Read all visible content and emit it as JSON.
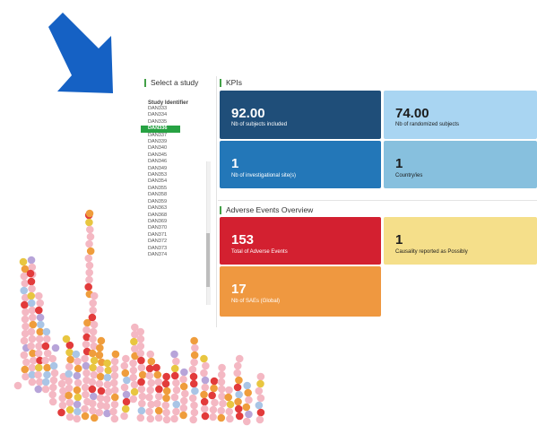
{
  "sidebar": {
    "title": "Select a study",
    "column_header": "Study Identifier",
    "items": [
      {
        "label": "DAN333",
        "active": false
      },
      {
        "label": "DAN334",
        "active": false
      },
      {
        "label": "DAN335",
        "active": false
      },
      {
        "label": "DAN336",
        "active": true
      },
      {
        "label": "DAN337",
        "active": false
      },
      {
        "label": "DAN339",
        "active": false
      },
      {
        "label": "DAN340",
        "active": false
      },
      {
        "label": "DAN345",
        "active": false
      },
      {
        "label": "DAN346",
        "active": false
      },
      {
        "label": "DAN349",
        "active": false
      },
      {
        "label": "DAN353",
        "active": false
      },
      {
        "label": "DAN354",
        "active": false
      },
      {
        "label": "DAN355",
        "active": false
      },
      {
        "label": "DAN358",
        "active": false
      },
      {
        "label": "DAN359",
        "active": false
      },
      {
        "label": "DAN363",
        "active": false
      },
      {
        "label": "DAN368",
        "active": false
      },
      {
        "label": "DAN369",
        "active": false
      },
      {
        "label": "DAN370",
        "active": false
      },
      {
        "label": "DAN371",
        "active": false
      },
      {
        "label": "DAN372",
        "active": false
      },
      {
        "label": "DAN373",
        "active": false
      },
      {
        "label": "DAN374",
        "active": false
      }
    ]
  },
  "kpis": {
    "title": "KPIs",
    "tiles": [
      {
        "value": "92.00",
        "label": "Nb of subjects included",
        "color": "#1f4e79"
      },
      {
        "value": "74.00",
        "label": "Nb of randomized subjects",
        "color": "#a9d5f2"
      },
      {
        "value": "1",
        "label": "Nb of investigational site(s)",
        "color": "#2377b8"
      },
      {
        "value": "1",
        "label": "Country/ies",
        "color": "#87c0de"
      }
    ]
  },
  "adverse_events": {
    "title": "Adverse Events Overview",
    "tiles": [
      {
        "value": "153",
        "label": "Total of Adverse Events",
        "color": "#d32030"
      },
      {
        "value": "1",
        "label": "Causality reported as Possibly",
        "color": "#f5df8a"
      },
      {
        "value": "17",
        "label": "Nb of SAEs (Global)",
        "color": "#ef9840"
      }
    ]
  },
  "colors": {
    "arrow": "#1561c4",
    "accent_green": "#43a047",
    "scatter_palette": [
      "#f4b8c3",
      "#ef9d3c",
      "#e23b3b",
      "#a9c5e6",
      "#e8c640",
      "#b7a4d9"
    ]
  }
}
